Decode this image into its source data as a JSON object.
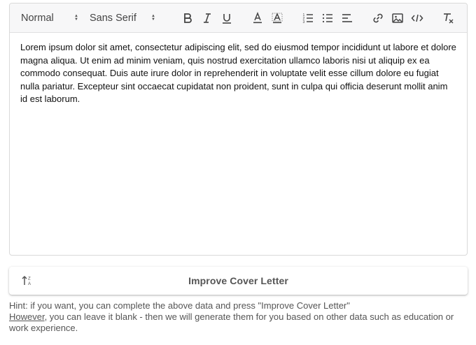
{
  "toolbar": {
    "format_select": "Normal",
    "font_select": "Sans Serif",
    "buttons": [
      {
        "name": "bold-icon"
      },
      {
        "name": "italic-icon"
      },
      {
        "name": "underline-icon"
      },
      {
        "name": "text-color-icon"
      },
      {
        "name": "background-color-icon"
      },
      {
        "name": "ordered-list-icon"
      },
      {
        "name": "bullet-list-icon"
      },
      {
        "name": "align-icon"
      },
      {
        "name": "link-icon"
      },
      {
        "name": "image-icon"
      },
      {
        "name": "code-icon"
      },
      {
        "name": "clear-format-icon"
      }
    ]
  },
  "editor": {
    "content": "Lorem ipsum dolor sit amet, consectetur adipiscing elit, sed do eiusmod tempor incididunt ut labore et dolore magna aliqua. Ut enim ad minim veniam, quis nostrud exercitation ullamco laboris nisi ut aliquip ex ea commodo consequat. Duis aute irure dolor in reprehenderit in voluptate velit esse cillum dolore eu fugiat nulla pariatur. Excepteur sint occaecat cupidatat non proident, sunt in culpa qui officia deserunt mollit anim id est laborum."
  },
  "improve_button": {
    "label": "Improve Cover Letter",
    "icon": "sort-icon"
  },
  "hint": {
    "line1": "Hint: if you want, you can complete the above data and press \"Improve Cover Letter\"",
    "underlined_word": "However",
    "line2_rest": ", you can leave it blank - then we will generate them for you based on other data such as education or work experience."
  },
  "colors": {
    "toolbar_bg": "#f7f7f8",
    "border": "#d9d9d9",
    "text": "#111111",
    "muted": "#555555"
  }
}
